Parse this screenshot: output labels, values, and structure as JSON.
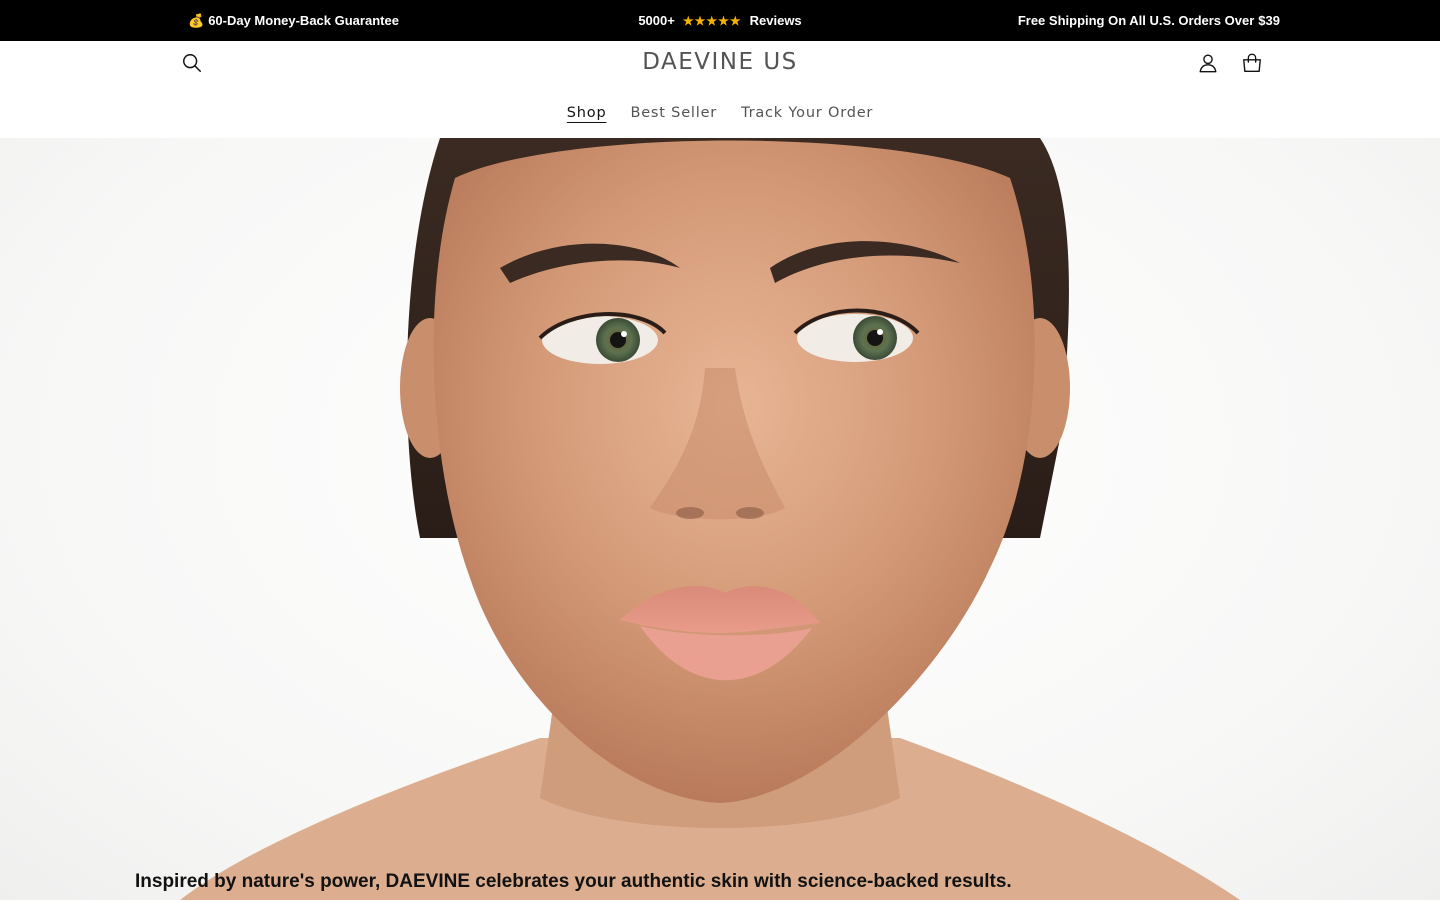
{
  "announcement": {
    "left_icon": "money-bag-icon",
    "left_text": "60-Day Money-Back Guarantee",
    "reviews_count": "5000+",
    "reviews_rating": 5,
    "reviews_label": "Reviews",
    "shipping_text": "Free Shipping On All U.S. Orders Over",
    "shipping_amount": "$39",
    "colors": {
      "background": "#000000",
      "text": "#ffffff",
      "stars": "#f5b301"
    }
  },
  "header": {
    "logo": "DAEVINE US",
    "icons": [
      "search-icon",
      "account-icon",
      "cart-icon"
    ],
    "nav": [
      {
        "label": "Shop",
        "active": true
      },
      {
        "label": "Best Seller",
        "active": false
      },
      {
        "label": "Track Your Order",
        "active": false
      }
    ]
  },
  "hero": {
    "caption": "Inspired by nature's power, DAEVINE celebrates your authentic skin with science-backed results."
  }
}
